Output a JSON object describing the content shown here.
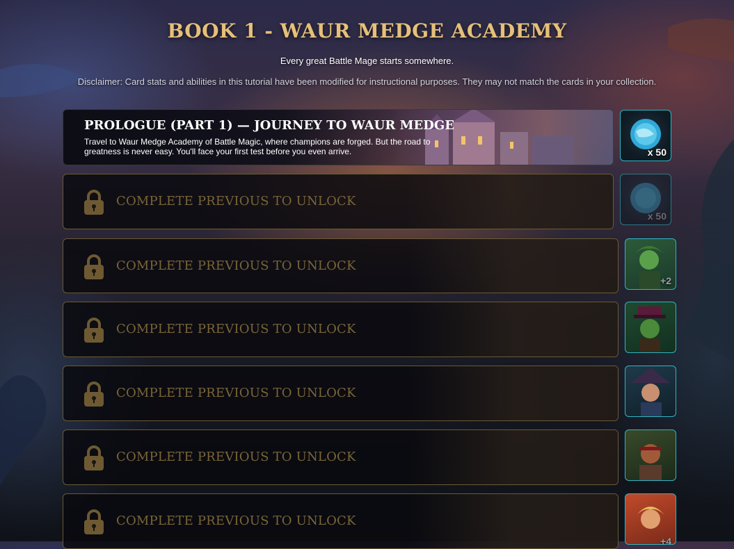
{
  "header": {
    "title": "BOOK 1 - WAUR MEDGE ACADEMY",
    "subtitle": "Every great Battle Mage starts somewhere.",
    "disclaimer": "Disclaimer: Card stats and abilities in this tutorial have been modified for instructional purposes. They may not match the cards in your collection."
  },
  "chapters": [
    {
      "title": "PROLOGUE (PART 1) — JOURNEY TO WAUR MEDGE",
      "description": "Travel to Waur Medge Academy of Battle Magic, where champions are forged. But the road to greatness is never easy. You'll face your first test before you even arrive.",
      "reward": {
        "icon": "mana-orb-icon",
        "quantity": "x 50"
      }
    },
    {
      "locked_label": "COMPLETE PREVIOUS TO UNLOCK",
      "reward": {
        "icon": "mana-orb-icon",
        "quantity": "x 50"
      }
    },
    {
      "locked_label": "COMPLETE PREVIOUS TO UNLOCK",
      "reward": {
        "icon": "character-card-icon",
        "quantity": "+2"
      }
    },
    {
      "locked_label": "COMPLETE PREVIOUS TO UNLOCK",
      "reward": {
        "icon": "character-card-icon"
      }
    },
    {
      "locked_label": "COMPLETE PREVIOUS TO UNLOCK",
      "reward": {
        "icon": "character-card-icon"
      }
    },
    {
      "locked_label": "COMPLETE PREVIOUS TO UNLOCK",
      "reward": {
        "icon": "character-card-icon"
      }
    },
    {
      "locked_label": "COMPLETE PREVIOUS TO UNLOCK",
      "reward": {
        "icon": "character-card-icon",
        "quantity": "+4"
      }
    }
  ],
  "colors": {
    "title_gold": "#e6c07a",
    "locked_text": "#7a6538",
    "reward_border": "#2fb5c2"
  }
}
